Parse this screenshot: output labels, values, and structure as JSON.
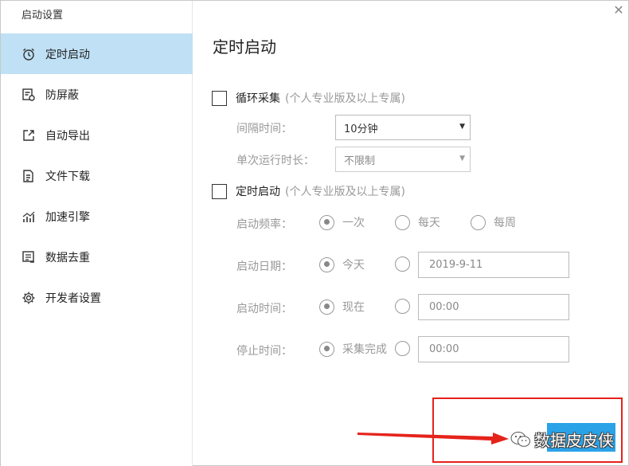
{
  "window": {
    "title": "启动设置"
  },
  "sidebar": {
    "items": [
      {
        "label": "定时启动",
        "icon": "alarm-clock-icon",
        "active": true
      },
      {
        "label": "防屏蔽",
        "icon": "shield-list-icon",
        "active": false
      },
      {
        "label": "自动导出",
        "icon": "export-icon",
        "active": false
      },
      {
        "label": "文件下载",
        "icon": "file-download-icon",
        "active": false
      },
      {
        "label": "加速引擎",
        "icon": "chart-rising-icon",
        "active": false
      },
      {
        "label": "数据去重",
        "icon": "dedupe-list-icon",
        "active": false
      },
      {
        "label": "开发者设置",
        "icon": "gear-icon",
        "active": false
      }
    ]
  },
  "main": {
    "title": "定时启动",
    "close_icon": "close-icon",
    "loop_collect": {
      "label": "循环采集",
      "note": "(个人专业版及以上专属)",
      "checked": false,
      "interval_label": "间隔时间：",
      "interval_value": "10分钟",
      "run_duration_label": "单次运行时长：",
      "run_duration_value": "不限制"
    },
    "scheduled_start": {
      "label": "定时启动",
      "note": "(个人专业版及以上专属)",
      "checked": false,
      "frequency_label": "启动频率：",
      "frequency_options": [
        "一次",
        "每天",
        "每周"
      ],
      "frequency_selected": "一次",
      "date_label": "启动日期：",
      "date_option": "今天",
      "date_value": "2019-9-11",
      "time_label": "启动时间：",
      "time_option": "现在",
      "time_value": "00:00",
      "stop_label": "停止时间：",
      "stop_option": "采集完成",
      "stop_value": "00:00"
    }
  },
  "watermark": {
    "text": "数据皮皮侠",
    "icon": "wechat-icon"
  },
  "colors": {
    "sidebar_active": "#bfe0f5",
    "annotation_red": "#e5231b",
    "button_blue": "#2aa2e8"
  }
}
